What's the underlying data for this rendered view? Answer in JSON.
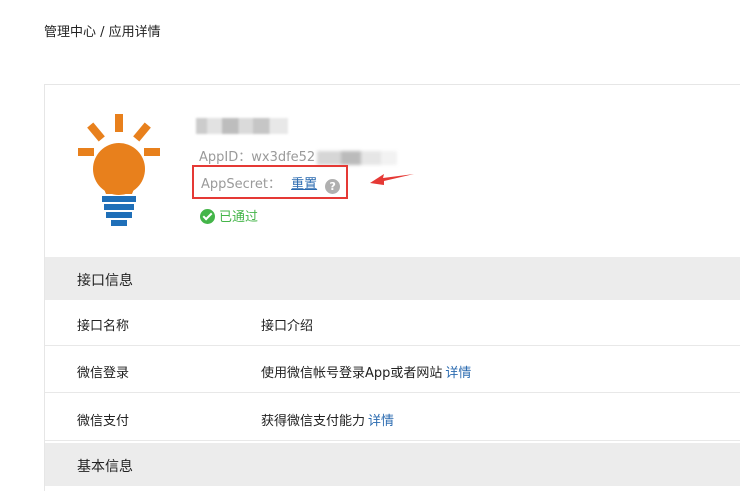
{
  "breadcrumb": "管理中心 / 应用详情",
  "app": {
    "id_label": "AppID：wx3dfe52",
    "secret_label": "AppSecret：",
    "reset_label": "重置",
    "help_glyph": "?",
    "status": "已通过"
  },
  "sections": {
    "interface_title": "接口信息",
    "basic_title": "基本信息"
  },
  "table": {
    "header": {
      "name": "接口名称",
      "desc": "接口介绍"
    },
    "rows": [
      {
        "name": "微信登录",
        "desc": "使用微信帐号登录App或者网站",
        "link": "详情"
      },
      {
        "name": "微信支付",
        "desc": "获得微信支付能力",
        "link": "详情"
      }
    ]
  },
  "colors": {
    "accent_link": "#2b6bb0",
    "status_green": "#44b549",
    "highlight_red": "#e53935",
    "icon_orange": "#e8801c",
    "icon_blue": "#1f6fb8"
  },
  "icons": {
    "app": "lightbulb-icon",
    "help": "question-circle-icon",
    "status": "check-circle-icon",
    "annotation": "red-arrow"
  }
}
